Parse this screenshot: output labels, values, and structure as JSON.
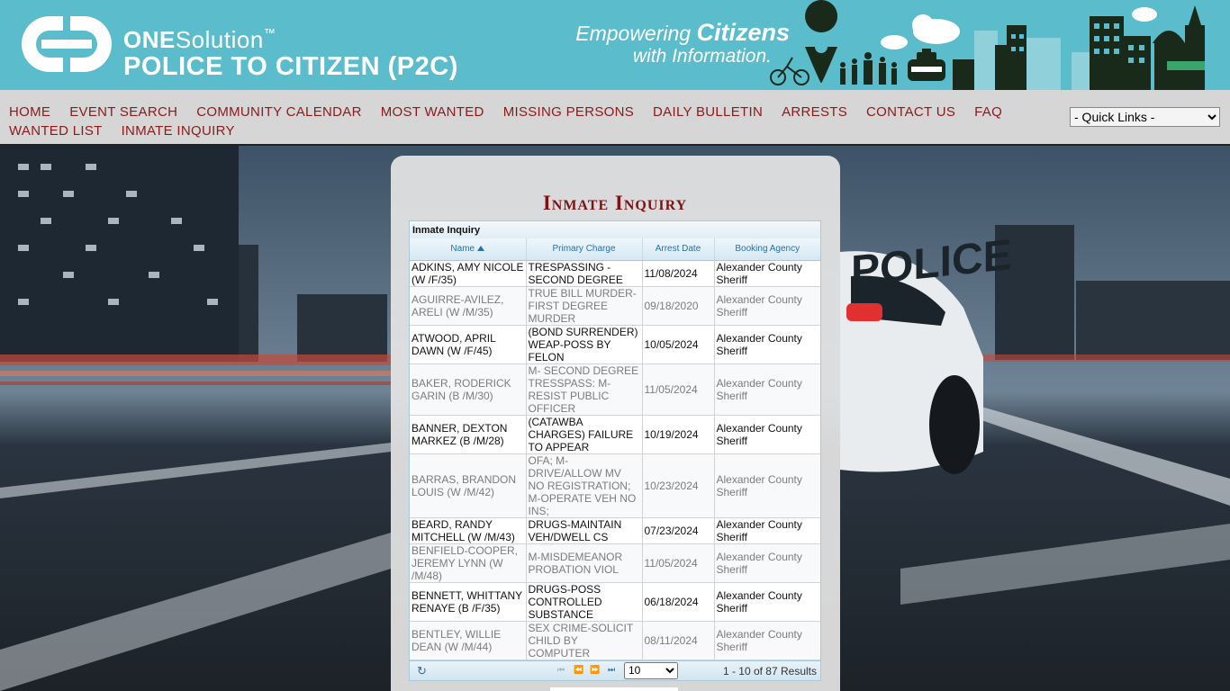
{
  "brand": {
    "line1_bold": "ONE",
    "line1_rest": "Solution",
    "trademark": "™",
    "line2": "POLICE TO CITIZEN (P2C)",
    "tagline_prefix": "Empowering ",
    "tagline_emphasis": "Citizens",
    "tagline_line2": "with Information."
  },
  "nav": {
    "links": [
      "HOME",
      "EVENT SEARCH",
      "COMMUNITY CALENDAR",
      "MOST WANTED",
      "MISSING PERSONS",
      "DAILY BULLETIN",
      "ARRESTS",
      "CONTACT US",
      "FAQ",
      "WANTED LIST",
      "INMATE INQUIRY"
    ],
    "quick_links": "- Quick Links -"
  },
  "page": {
    "title": "Inmate Inquiry"
  },
  "grid": {
    "caption": "Inmate Inquiry",
    "columns": [
      "Name",
      "Primary Charge",
      "Arrest Date",
      "Booking Agency"
    ],
    "sorted_column": "Name",
    "rows": [
      {
        "name": "ADKINS, AMY NICOLE (W /F/35)",
        "charge": "TRESPASSING - SECOND DEGREE",
        "date": "11/08/2024",
        "agency": "Alexander County Sheriff"
      },
      {
        "name": "AGUIRRE-AVILEZ, ARELI (W /M/35)",
        "charge": "TRUE BILL MURDER-FIRST DEGREE MURDER",
        "date": "09/18/2020",
        "agency": "Alexander County Sheriff"
      },
      {
        "name": "ATWOOD, APRIL DAWN (W /F/45)",
        "charge": "(BOND SURRENDER) WEAP-POSS BY FELON",
        "date": "10/05/2024",
        "agency": "Alexander County Sheriff"
      },
      {
        "name": "BAKER, RODERICK GARIN (B /M/30)",
        "charge": "M- SECOND DEGREE TRESSPASS: M-RESIST PUBLIC OFFICER",
        "date": "11/05/2024",
        "agency": "Alexander County Sheriff"
      },
      {
        "name": "BANNER, DEXTON MARKEZ (B /M/28)",
        "charge": "(CATAWBA CHARGES) FAILURE TO APPEAR",
        "date": "10/19/2024",
        "agency": "Alexander County Sheriff"
      },
      {
        "name": "BARRAS, BRANDON LOUIS (W /M/42)",
        "charge": "OFA; M-DRIVE/ALLOW MV NO REGISTRATION; M-OPERATE VEH NO INS;",
        "date": "10/23/2024",
        "agency": "Alexander County Sheriff"
      },
      {
        "name": "BEARD, RANDY MITCHELL (W /M/43)",
        "charge": "DRUGS-MAINTAIN VEH/DWELL CS",
        "date": "07/23/2024",
        "agency": "Alexander County Sheriff"
      },
      {
        "name": "BENFIELD-COOPER, JEREMY LYNN (W /M/48)",
        "charge": "M-MISDEMEANOR PROBATION VIOL",
        "date": "11/05/2024",
        "agency": "Alexander County Sheriff"
      },
      {
        "name": "BENNETT, WHITTANY RENAYE (B /F/35)",
        "charge": "DRUGS-POSS CONTROLLED SUBSTANCE",
        "date": "06/18/2024",
        "agency": "Alexander County Sheriff"
      },
      {
        "name": "BENTLEY, WILLIE DEAN (W /M/44)",
        "charge": "SEX CRIME-SOLICIT CHILD BY COMPUTER",
        "date": "08/11/2024",
        "agency": "Alexander County Sheriff"
      }
    ],
    "pager": {
      "page_size": "10",
      "page_size_options": [
        "10"
      ],
      "results": "1 - 10 of 87 Results"
    }
  },
  "colors": {
    "banner": "#5bbccc",
    "nav_bg": "#d6d6d6",
    "nav_text": "#8b1a1a",
    "title": "#7a1414",
    "grid_header_text": "#2a6fa5"
  }
}
